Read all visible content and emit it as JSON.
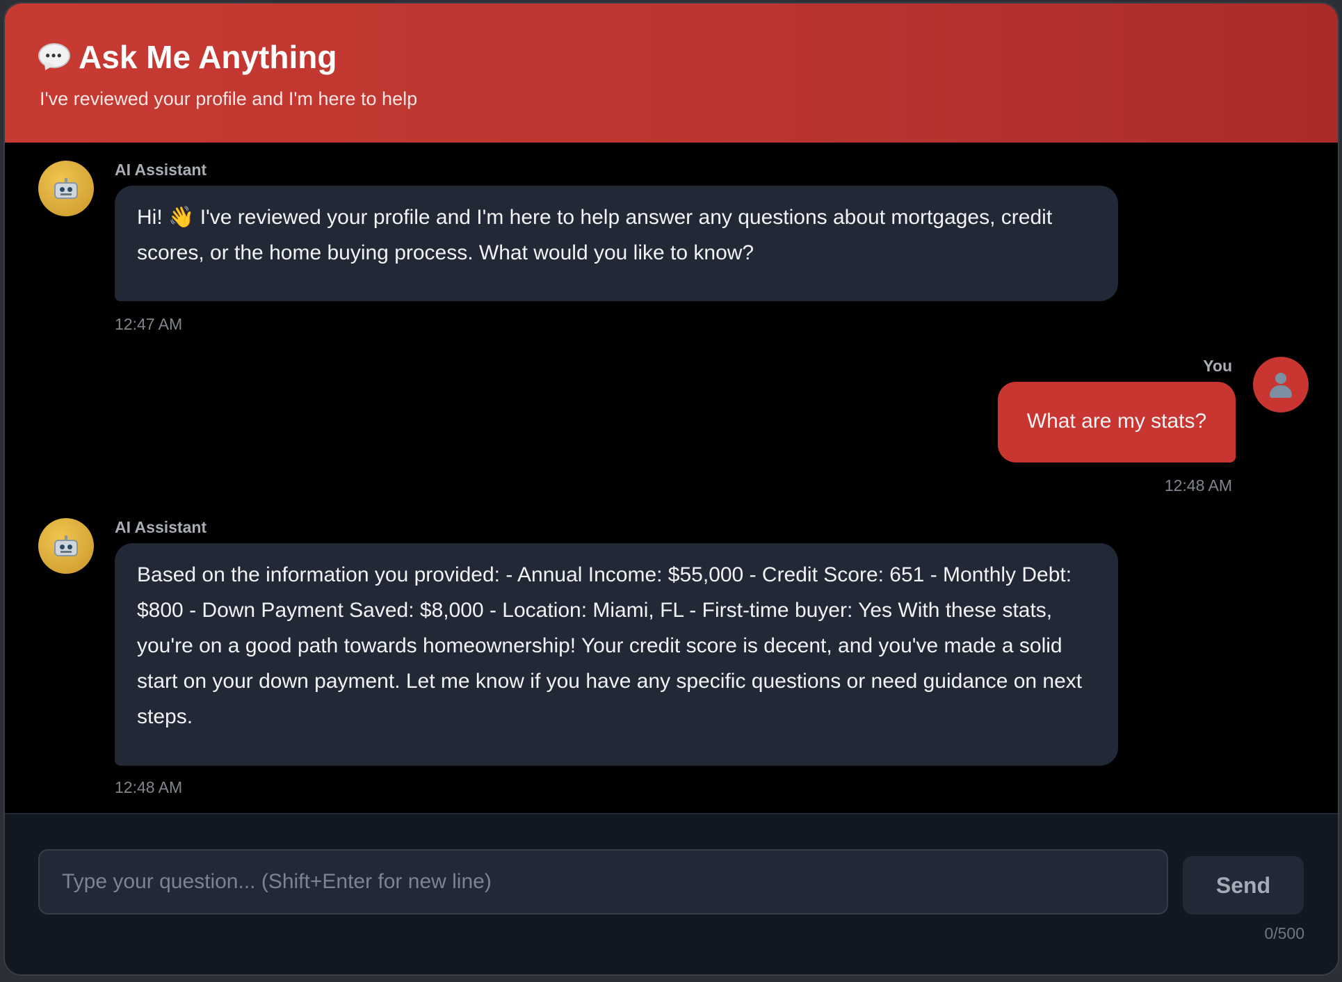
{
  "header": {
    "title": "Ask Me Anything",
    "title_icon": "speech-bubble-icon",
    "subtitle": "I've reviewed your profile and I'm here to help"
  },
  "messages": [
    {
      "role": "assistant",
      "sender": "AI Assistant",
      "avatar_icon": "robot-icon",
      "text": "Hi! 👋 I've reviewed your profile and I'm here to help answer any questions about mortgages, credit scores, or the home buying process. What would you like to know?",
      "time": "12:47 AM"
    },
    {
      "role": "user",
      "sender": "You",
      "avatar_icon": "user-silhouette-icon",
      "text": "What are my stats?",
      "time": "12:48 AM"
    },
    {
      "role": "assistant",
      "sender": "AI Assistant",
      "avatar_icon": "robot-icon",
      "text": "Based on the information you provided: - Annual Income: $55,000 - Credit Score: 651 - Monthly Debt: $800 - Down Payment Saved: $8,000 - Location: Miami, FL - First-time buyer: Yes With these stats, you're on a good path towards homeownership! Your credit score is decent, and you've made a solid start on your down payment. Let me know if you have any specific questions or need guidance on next steps.",
      "time": "12:48 AM"
    }
  ],
  "composer": {
    "placeholder": "Type your question... (Shift+Enter for new line)",
    "value": "",
    "send_label": "Send",
    "counter": "0/500"
  },
  "colors": {
    "header_red": "#c73a32",
    "user_bubble": "#c93530",
    "assistant_bubble": "#222836",
    "background": "#000000",
    "footer": "#121822"
  }
}
